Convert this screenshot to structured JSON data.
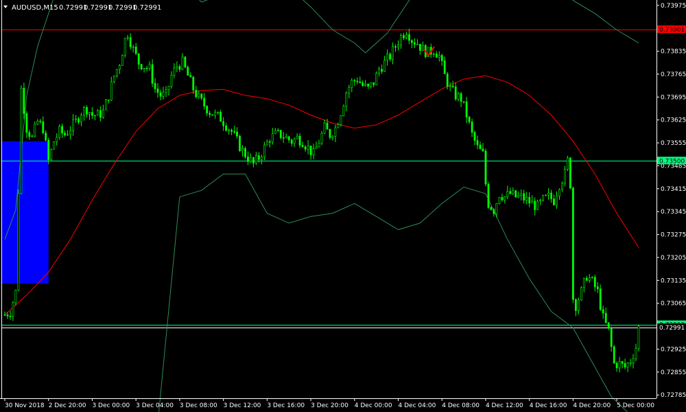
{
  "header": {
    "symbol": "AUDUSD,M15",
    "open": "0.72991",
    "high": "0.72991",
    "low": "0.72991",
    "close": "0.72991",
    "dropdown_icon": "triangle-down-icon"
  },
  "colors": {
    "background": "#000000",
    "bull_candle": "#00ff00",
    "bear_candle": "#00ff00",
    "bollinger_outer": "#2e8b57",
    "moving_average": "#ff0000",
    "level_red": "#ff0000",
    "level_green": "#00ff7f",
    "highlight_box": "#0000ff",
    "axis": "#ffffff"
  },
  "chart_data": {
    "type": "candlestick",
    "symbol": "AUDUSD",
    "timeframe": "M15",
    "y_axis_labels": [
      "0.73975",
      "0.73905",
      "0.73835",
      "0.73765",
      "0.73695",
      "0.73625",
      "0.73555",
      "0.73485",
      "0.73415",
      "0.73345",
      "0.73275",
      "0.73205",
      "0.73135",
      "0.73065",
      "0.72995",
      "0.72925",
      "0.72855",
      "0.72785"
    ],
    "ylim": [
      0.72775,
      0.73985
    ],
    "x_axis_labels": [
      "30 Nov 2018",
      "2 Dec 20:00",
      "3 Dec 00:00",
      "3 Dec 04:00",
      "3 Dec 08:00",
      "3 Dec 12:00",
      "3 Dec 16:00",
      "3 Dec 20:00",
      "4 Dec 00:00",
      "4 Dec 04:00",
      "4 Dec 08:00",
      "4 Dec 12:00",
      "4 Dec 16:00",
      "4 Dec 20:00",
      "5 Dec 00:00"
    ],
    "horizontal_levels": [
      {
        "price": 0.73901,
        "label": "0.73901",
        "color": "#ff0000"
      },
      {
        "price": 0.735,
        "label": "0.73500",
        "color": "#00ff7f"
      },
      {
        "price": 0.73,
        "label": "0.73000",
        "color": "#00ff7f"
      },
      {
        "price": 0.72991,
        "label": "0.72991",
        "color": "#ffffff"
      }
    ],
    "highlight_zone": {
      "price_top": 0.7356,
      "price_bottom": 0.73125,
      "time_index_start": 0,
      "time_index_end": 16
    },
    "close_path": [
      [
        0,
        0.7303
      ],
      [
        2,
        0.7304
      ],
      [
        4,
        0.731
      ],
      [
        6,
        0.7372
      ],
      [
        8,
        0.736
      ],
      [
        10,
        0.7357
      ],
      [
        12,
        0.7362
      ],
      [
        14,
        0.736
      ],
      [
        16,
        0.735
      ],
      [
        18,
        0.7356
      ],
      [
        20,
        0.7359
      ],
      [
        22,
        0.7358
      ],
      [
        24,
        0.736
      ],
      [
        26,
        0.7362
      ],
      [
        28,
        0.7365
      ],
      [
        30,
        0.7366
      ],
      [
        32,
        0.7364
      ],
      [
        34,
        0.7364
      ],
      [
        36,
        0.7365
      ],
      [
        38,
        0.737
      ],
      [
        40,
        0.7376
      ],
      [
        42,
        0.738
      ],
      [
        44,
        0.7387
      ],
      [
        45,
        0.7389
      ],
      [
        47,
        0.7384
      ],
      [
        49,
        0.738
      ],
      [
        51,
        0.7379
      ],
      [
        53,
        0.7378
      ],
      [
        55,
        0.7372
      ],
      [
        57,
        0.737
      ],
      [
        59,
        0.737
      ],
      [
        61,
        0.7376
      ],
      [
        63,
        0.7379
      ],
      [
        65,
        0.738
      ],
      [
        67,
        0.7376
      ],
      [
        69,
        0.7372
      ],
      [
        71,
        0.7369
      ],
      [
        73,
        0.7367
      ],
      [
        75,
        0.7365
      ],
      [
        77,
        0.7364
      ],
      [
        79,
        0.7363
      ],
      [
        81,
        0.7361
      ],
      [
        83,
        0.7359
      ],
      [
        85,
        0.7356
      ],
      [
        87,
        0.7353
      ],
      [
        89,
        0.7351
      ],
      [
        91,
        0.7349
      ],
      [
        93,
        0.7351
      ],
      [
        95,
        0.7354
      ],
      [
        97,
        0.7357
      ],
      [
        99,
        0.7358
      ],
      [
        101,
        0.7358
      ],
      [
        103,
        0.7357
      ],
      [
        105,
        0.7356
      ],
      [
        107,
        0.7357
      ],
      [
        109,
        0.7356
      ],
      [
        111,
        0.7354
      ],
      [
        113,
        0.7352
      ],
      [
        115,
        0.7356
      ],
      [
        117,
        0.736
      ],
      [
        119,
        0.7358
      ],
      [
        121,
        0.736
      ],
      [
        123,
        0.7365
      ],
      [
        125,
        0.7371
      ],
      [
        127,
        0.7374
      ],
      [
        129,
        0.7375
      ],
      [
        131,
        0.7373
      ],
      [
        133,
        0.7372
      ],
      [
        135,
        0.7374
      ],
      [
        137,
        0.7378
      ],
      [
        139,
        0.738
      ],
      [
        141,
        0.7382
      ],
      [
        143,
        0.7385
      ],
      [
        145,
        0.7388
      ],
      [
        147,
        0.739
      ],
      [
        149,
        0.7387
      ],
      [
        151,
        0.7386
      ],
      [
        153,
        0.7384
      ],
      [
        155,
        0.7383
      ],
      [
        157,
        0.7384
      ],
      [
        159,
        0.7382
      ],
      [
        161,
        0.7376
      ],
      [
        163,
        0.7372
      ],
      [
        165,
        0.737
      ],
      [
        167,
        0.7369
      ],
      [
        169,
        0.7364
      ],
      [
        171,
        0.7358
      ],
      [
        173,
        0.7354
      ],
      [
        175,
        0.7352
      ],
      [
        176,
        0.7343
      ],
      [
        177,
        0.7337
      ],
      [
        179,
        0.7335
      ],
      [
        181,
        0.734
      ],
      [
        183,
        0.7339
      ],
      [
        185,
        0.734
      ],
      [
        187,
        0.7339
      ],
      [
        189,
        0.7339
      ],
      [
        191,
        0.7338
      ],
      [
        193,
        0.7337
      ],
      [
        195,
        0.7336
      ],
      [
        197,
        0.7338
      ],
      [
        199,
        0.7339
      ],
      [
        201,
        0.7338
      ],
      [
        203,
        0.7343
      ],
      [
        205,
        0.7346
      ],
      [
        206,
        0.735
      ],
      [
        207,
        0.7343
      ],
      [
        208,
        0.7308
      ],
      [
        209,
        0.7306
      ],
      [
        211,
        0.731
      ],
      [
        213,
        0.7315
      ],
      [
        215,
        0.7313
      ],
      [
        217,
        0.731
      ],
      [
        219,
        0.7302
      ],
      [
        221,
        0.7298
      ],
      [
        223,
        0.7288
      ],
      [
        225,
        0.7288
      ],
      [
        227,
        0.7287
      ],
      [
        229,
        0.7289
      ],
      [
        231,
        0.7293
      ],
      [
        232,
        0.72991
      ]
    ],
    "moving_average_path": [
      [
        0,
        0.7303
      ],
      [
        8,
        0.7309
      ],
      [
        16,
        0.7316
      ],
      [
        24,
        0.7326
      ],
      [
        32,
        0.7338
      ],
      [
        40,
        0.7349
      ],
      [
        48,
        0.7359
      ],
      [
        56,
        0.7366
      ],
      [
        64,
        0.737
      ],
      [
        72,
        0.73715
      ],
      [
        80,
        0.73718
      ],
      [
        88,
        0.737
      ],
      [
        96,
        0.7369
      ],
      [
        104,
        0.7367
      ],
      [
        112,
        0.7364
      ],
      [
        120,
        0.73615
      ],
      [
        128,
        0.736
      ],
      [
        136,
        0.7361
      ],
      [
        144,
        0.7364
      ],
      [
        152,
        0.7368
      ],
      [
        160,
        0.7372
      ],
      [
        168,
        0.7375
      ],
      [
        176,
        0.7376
      ],
      [
        184,
        0.7374
      ],
      [
        192,
        0.737
      ],
      [
        200,
        0.7364
      ],
      [
        208,
        0.7356
      ],
      [
        216,
        0.7346
      ],
      [
        224,
        0.7334
      ],
      [
        232,
        0.73235
      ]
    ],
    "bollinger_upper_path": [
      [
        0,
        0.7326
      ],
      [
        4,
        0.7335
      ],
      [
        8,
        0.737
      ],
      [
        12,
        0.7385
      ],
      [
        16,
        0.7395
      ],
      [
        20,
        0.7405
      ],
      [
        64,
        0.7405
      ],
      [
        72,
        0.73985
      ],
      [
        80,
        0.7401
      ],
      [
        88,
        0.7403
      ],
      [
        104,
        0.7403
      ],
      [
        112,
        0.7397
      ],
      [
        120,
        0.739
      ],
      [
        128,
        0.7386
      ],
      [
        132,
        0.7383
      ],
      [
        140,
        0.7389
      ],
      [
        148,
        0.7399
      ],
      [
        156,
        0.7405
      ],
      [
        176,
        0.7406
      ],
      [
        184,
        0.7403
      ],
      [
        200,
        0.7403
      ],
      [
        208,
        0.7399
      ],
      [
        216,
        0.7395
      ],
      [
        224,
        0.739
      ],
      [
        232,
        0.7386
      ]
    ],
    "bollinger_lower_path": [
      [
        40,
        0.727
      ],
      [
        56,
        0.727
      ],
      [
        64,
        0.7339
      ],
      [
        72,
        0.7341
      ],
      [
        80,
        0.7346
      ],
      [
        88,
        0.7346
      ],
      [
        96,
        0.7334
      ],
      [
        104,
        0.7331
      ],
      [
        112,
        0.7333
      ],
      [
        120,
        0.7334
      ],
      [
        128,
        0.7337
      ],
      [
        136,
        0.7333
      ],
      [
        144,
        0.7329
      ],
      [
        152,
        0.7331
      ],
      [
        160,
        0.7337
      ],
      [
        168,
        0.7342
      ],
      [
        176,
        0.734
      ],
      [
        184,
        0.7326
      ],
      [
        192,
        0.7314
      ],
      [
        200,
        0.7304
      ],
      [
        208,
        0.7299
      ],
      [
        216,
        0.7287
      ],
      [
        222,
        0.7278
      ],
      [
        232,
        0.727
      ]
    ],
    "arrow_marker": {
      "time_index": 155,
      "price": 0.7383,
      "color": "#ff0000"
    },
    "n_bars": 233
  }
}
